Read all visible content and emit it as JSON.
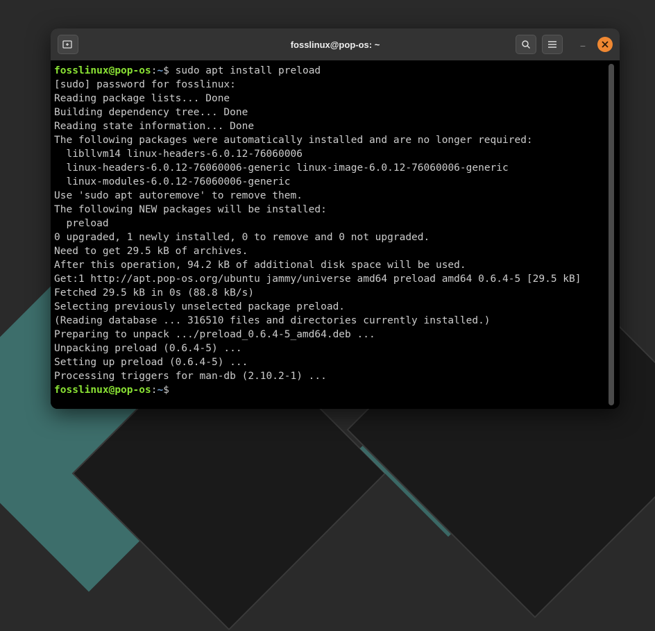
{
  "titlebar": {
    "title": "fosslinux@pop-os: ~"
  },
  "prompt": {
    "user": "fosslinux",
    "at": "@",
    "host": "pop-os",
    "colon": ":",
    "path": "~",
    "dollar": "$ "
  },
  "command": "sudo apt install preload",
  "output_lines": [
    "[sudo] password for fosslinux:",
    "Reading package lists... Done",
    "Building dependency tree... Done",
    "Reading state information... Done",
    "The following packages were automatically installed and are no longer required:",
    "  libllvm14 linux-headers-6.0.12-76060006",
    "  linux-headers-6.0.12-76060006-generic linux-image-6.0.12-76060006-generic",
    "  linux-modules-6.0.12-76060006-generic",
    "Use 'sudo apt autoremove' to remove them.",
    "The following NEW packages will be installed:",
    "  preload",
    "0 upgraded, 1 newly installed, 0 to remove and 0 not upgraded.",
    "Need to get 29.5 kB of archives.",
    "After this operation, 94.2 kB of additional disk space will be used.",
    "Get:1 http://apt.pop-os.org/ubuntu jammy/universe amd64 preload amd64 0.6.4-5 [29.5 kB]",
    "Fetched 29.5 kB in 0s (88.8 kB/s)",
    "Selecting previously unselected package preload.",
    "(Reading database ... 316510 files and directories currently installed.)",
    "Preparing to unpack .../preload_0.6.4-5_amd64.deb ...",
    "Unpacking preload (0.6.4-5) ...",
    "Setting up preload (0.6.4-5) ...",
    "Processing triggers for man-db (2.10.2-1) ..."
  ]
}
